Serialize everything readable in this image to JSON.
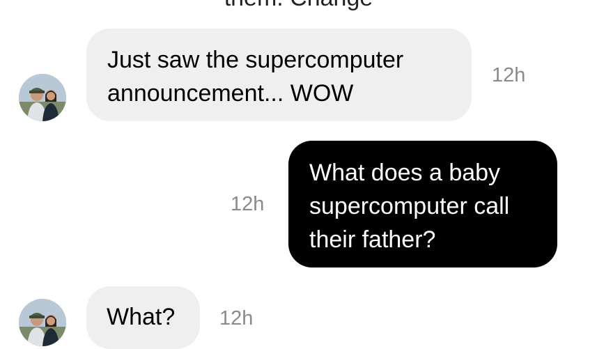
{
  "header": {
    "partial_title": "them. Change"
  },
  "messages": [
    {
      "direction": "incoming",
      "lines": [
        "Just saw the supercomputer",
        "announcement... WOW"
      ],
      "time": "12h"
    },
    {
      "direction": "outgoing",
      "lines": [
        "What does a baby",
        "supercomputer call",
        "their father?"
      ],
      "time": "12h"
    },
    {
      "direction": "incoming",
      "lines": [
        "What?"
      ],
      "time": "12h"
    }
  ],
  "colors": {
    "incoming_bubble": "#efefef",
    "outgoing_bubble": "#000000",
    "timestamp": "#8a8a8a"
  },
  "icons": {
    "avatar": "profile-photo-two-people"
  }
}
